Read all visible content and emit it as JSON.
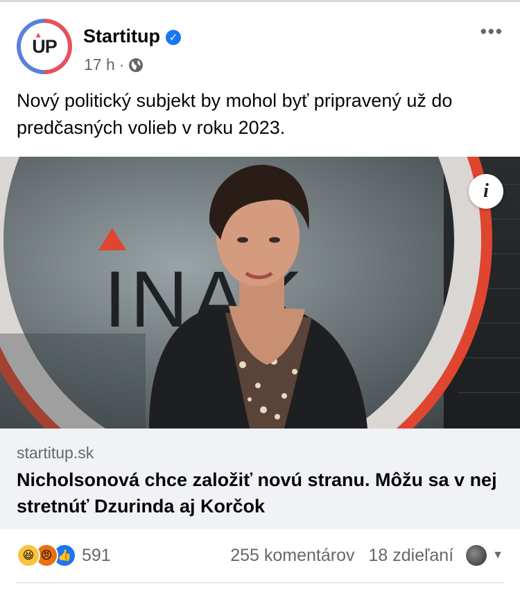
{
  "post": {
    "page_name": "Startitup",
    "avatar_text": "UP",
    "time": "17 h",
    "separator": "·",
    "more": "•••",
    "text": "Nový politický subjekt by mohol byť pripravený už do predčasných volieb v roku 2023."
  },
  "image": {
    "background_lettering": "INAK",
    "info_label": "i"
  },
  "link": {
    "domain": "startitup.sk",
    "title": "Nicholsonová chce založiť novú stranu. Môžu sa v nej stretnúť Dzurinda aj Korčok"
  },
  "engagement": {
    "reactions_count": "591",
    "comments": "255 komentárov",
    "shares": "18 zdieľaní"
  },
  "colors": {
    "accent": "#1877f2",
    "secondary_text": "#65676b",
    "card_bg": "#f0f2f5"
  },
  "icons": [
    "globe-icon",
    "verified-badge-icon",
    "more-options-icon",
    "info-icon",
    "haha-reaction-icon",
    "angry-reaction-icon",
    "like-reaction-icon",
    "chevron-down-icon"
  ]
}
